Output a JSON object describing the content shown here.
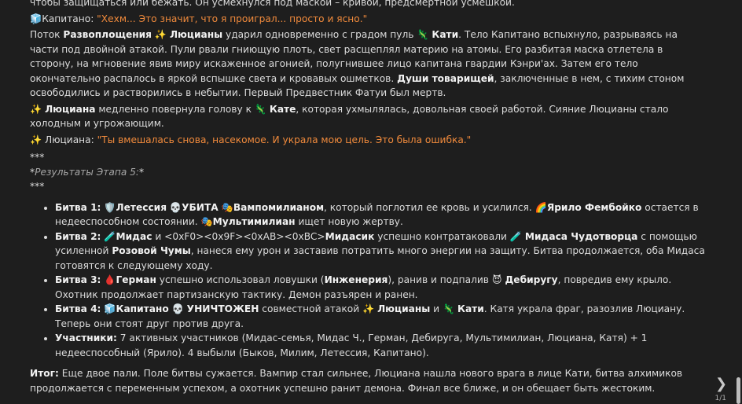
{
  "p0": "чтобы защищаться или бежать. Он усмехнулся под маской – кривой, предсмертной усмешкой.",
  "p1": {
    "icon": "🧊",
    "speaker": "Капитано:",
    "quote": "\"Хехм... Это значит, что я проиграл... просто и ясно.\""
  },
  "p2": {
    "s1": "Поток ",
    "b1": "Развоплощения",
    "s2": " ✨ ",
    "b2": "Люцианы",
    "s3": " ударил одновременно с градом пуль 🦎 ",
    "b3": "Кати",
    "s4": ". Тело Капитано вспыхнуло, разрываясь на части под двойной атакой. Пули рвали гниющую плоть, свет расщеплял материю на атомы. Его разбитая маска отлетела в сторону, на мгновение явив миру искаженное агонией, полугнившее лицо капитана гвардии Кэнри'ах. Затем его тело окончательно распалось в яркой вспышке света и кровавых ошметков. ",
    "b4": "Души товарищей",
    "s5": ", заключенные в нем, с тихим стоном освободились и растворились в небытии. Первый Предвестник Фатуи был мертв."
  },
  "p3": {
    "s1": "✨ ",
    "b1": "Люциана",
    "s2": " медленно повернула голову к 🦎 ",
    "b2": "Кате",
    "s3": ", которая ухмылялась, довольная своей работой. Сияние Люцианы стало холодным и угрожающим."
  },
  "p4": {
    "speaker": "✨ Люциана: ",
    "quote": "\"Ты вмешалась снова, насекомое. И украла мою цель. Это была ошибка.\""
  },
  "sep1": "***",
  "results_heading": "Результаты Этапа 5:",
  "sep2": "***",
  "battles": [
    {
      "label": "Битва 1:",
      "s1": " 🛡️",
      "b1": "Летессия",
      "s2": " 💀",
      "b2": "УБИТА",
      "s3": " 🎭",
      "b3": "Вампомилианом",
      "s4": ", который поглотил ее кровь и усилился. 🌈",
      "b4": "Ярило Фембойко",
      "s5": " остается в недееспособном состоянии. 🎭",
      "b5": "Мультимилиан",
      "s6": " ищет новую жертву."
    },
    {
      "label": "Битва 2:",
      "s1": " 🧪",
      "b1": "Мидас",
      "s2": " и <0xF0><0x9F><0xAB><0xBC>",
      "b2": "Мидасик",
      "s3": " успешно контратаковали 🧪 ",
      "b3": "Мидаса Чудотворца",
      "s4": " с помощью усиленной ",
      "b4": "Розовой Чумы",
      "s5": ", нанеся ему урон и заставив потратить много энергии на защиту. Битва продолжается, оба Мидаса готовятся к следующему ходу."
    },
    {
      "label": "Битва 3:",
      "s1": " 🩸",
      "b1": "Герман",
      "s2": " успешно использовал ловушки (",
      "b2": "Инженерия",
      "s3": "), ранив и подпалив 😈 ",
      "b3": "Дебиругу",
      "s4": ", повредив ему крыло. Охотник продолжает партизанскую тактику. Демон разъярен и ранен."
    },
    {
      "label": "Битва 4:",
      "s1": " 🧊",
      "b1": "Капитано",
      "s2": " 💀 ",
      "b2": "УНИЧТОЖЕН",
      "s3": " совместной атакой ✨ ",
      "b3": "Люцианы",
      "s4": " и 🦎 ",
      "b4": "Кати",
      "s5": ". Катя украла фраг, разозлив Люциану. Теперь они стоят друг против друга."
    },
    {
      "label": "Участники:",
      "s1": " 7 активных участников (Мидас-семья, Мидас Ч., Герман, Дебируга, Мультимилиан, Люциана, Катя) + 1 недееспособный (Ярило). 4 выбыли (Быков, Милим, Летессия, Капитано)."
    }
  ],
  "summary": {
    "label": "Итог:",
    "text": " Еще двое пали. Поле битвы сужается. Вампир стал сильнее, Люциана нашла нового врага в лице Кати, битва алхимиков продолжается с переменным успехом, а охотник успешно ранит демона. Финал все ближе, и он обещает быть жестоким."
  },
  "nav": {
    "next_icon": "chevron-right-icon",
    "next_glyph": "❯",
    "page_counter": "1/1"
  }
}
